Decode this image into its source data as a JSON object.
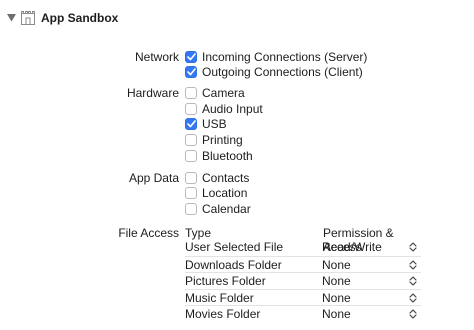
{
  "header": {
    "title": "App Sandbox",
    "disclosure_icon": "disclosure-triangle-down",
    "section_icon": "sandbox-icon"
  },
  "network": {
    "label": "Network",
    "options": [
      {
        "label": "Incoming Connections (Server)",
        "checked": true
      },
      {
        "label": "Outgoing Connections (Client)",
        "checked": true
      }
    ]
  },
  "hardware": {
    "label": "Hardware",
    "options": [
      {
        "label": "Camera",
        "checked": false
      },
      {
        "label": "Audio Input",
        "checked": false
      },
      {
        "label": "USB",
        "checked": true
      },
      {
        "label": "Printing",
        "checked": false
      },
      {
        "label": "Bluetooth",
        "checked": false
      }
    ]
  },
  "app_data": {
    "label": "App Data",
    "options": [
      {
        "label": "Contacts",
        "checked": false
      },
      {
        "label": "Location",
        "checked": false
      },
      {
        "label": "Calendar",
        "checked": false
      }
    ]
  },
  "file_access": {
    "label": "File Access",
    "columns": {
      "type": "Type",
      "permission": "Permission & Access"
    },
    "rows": [
      {
        "type": "User Selected File",
        "permission": "Read/Write"
      },
      {
        "type": "Downloads Folder",
        "permission": "None"
      },
      {
        "type": "Pictures Folder",
        "permission": "None"
      },
      {
        "type": "Music Folder",
        "permission": "None"
      },
      {
        "type": "Movies Folder",
        "permission": "None"
      }
    ]
  },
  "colors": {
    "accent": "#3478f6",
    "text": "#1d1d1f",
    "divider": "#e3e3e3"
  }
}
